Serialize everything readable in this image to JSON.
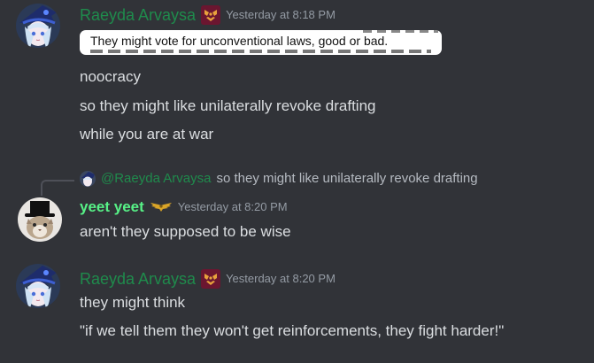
{
  "colors": {
    "background": "#313338",
    "message_text": "#dbdee1",
    "timestamp": "#949ba4",
    "raeyda_name": "#1f8b4c",
    "yeet_name": "#57f287"
  },
  "messages": [
    {
      "author": "Raeyda Arvaysa",
      "role_icon": "maroon-emblem-icon",
      "timestamp": "Yesterday at 8:18 PM",
      "attachment_caption": "They might vote for unconventional laws, good or bad.",
      "lines": [
        "noocracy",
        "so they might like unilaterally revoke drafting",
        "while you are at war"
      ]
    },
    {
      "reply_to": {
        "author": "@Raeyda Arvaysa",
        "text": "so they might like unilaterally revoke drafting"
      },
      "author": "yeet yeet",
      "role_icon": "golden-wings-icon",
      "timestamp": "Yesterday at 8:20 PM",
      "lines": [
        "aren't they supposed to be wise"
      ]
    },
    {
      "author": "Raeyda Arvaysa",
      "role_icon": "maroon-emblem-icon",
      "timestamp": "Yesterday at 8:20 PM",
      "lines": [
        "they might think",
        "\"if we tell them they won't get reinforcements, they fight harder!\""
      ]
    }
  ]
}
